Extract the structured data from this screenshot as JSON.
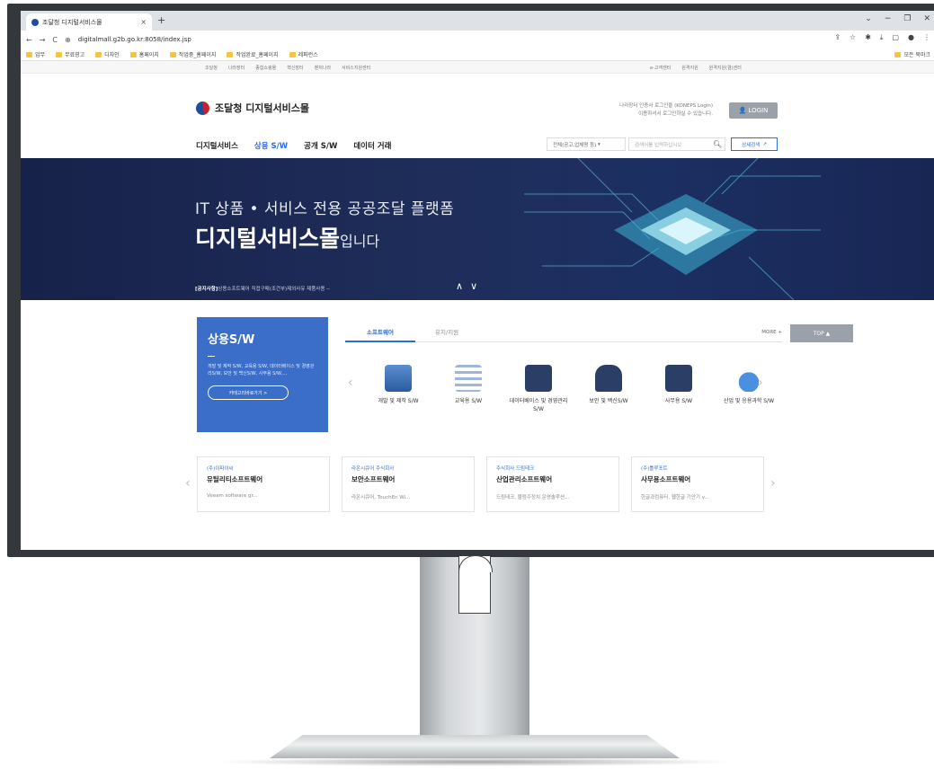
{
  "browser": {
    "tab_title": "조달청 디지털서비스몰",
    "tab_close": "×",
    "new_tab": "+",
    "url": "digitalmall.g2b.go.kr:8058/index.jsp",
    "bookmarks": [
      "업무",
      "무료광고",
      "디자인",
      "홈페이지",
      "작업중_홈페이지",
      "작업완료_홈페이지",
      "레퍼런스"
    ],
    "all_bookmarks": "모든 북마크"
  },
  "util_nav": {
    "left": [
      "조달청",
      "나라장터",
      "종합쇼핑몰",
      "혁신장터",
      "벤처나라",
      "서비스지원센터"
    ],
    "right": [
      "e-고객센터",
      "원격지원",
      "원격지원(결)센터"
    ]
  },
  "header": {
    "logo_text": "조달청 디지털서비스몰",
    "login_note_1": "나라장터 인증서 로그인을 (KONEPS Login)",
    "login_note_2": "이용하셔서 로그인하실 수 있습니다.",
    "login_label": "LOGIN"
  },
  "nav": {
    "items": [
      "디지털서비스",
      "상용 S/W",
      "공개 S/W",
      "데이터 거래"
    ],
    "search_select": "전체(공고,업체명 등)",
    "search_placeholder": "검색어를 입력하십시오",
    "detail_search": "상세검색"
  },
  "hero": {
    "line1": "IT 상품 • 서비스 전용 공공조달 플랫폼",
    "line2_bold": "디지털서비스몰",
    "line2_rest": "입니다",
    "notice_tag": "[공지사항]",
    "notice_text": "상용소프트웨어 직접구매(조건부)제외사유 제품사용 --",
    "arrows": "^ v"
  },
  "promo": {
    "title": "상용S/W",
    "desc": "개발 및 제작 S/W, 교육용 S/W, 데이터베이스 및 경영관리S/W, 보안 및 백신S/W, 사무용 S/W,...",
    "button": "카테고리바로가기 >"
  },
  "section_tabs": {
    "tab1": "소프트웨어",
    "tab2": "유지/지원",
    "more": "MORE +",
    "top": "TOP ▲"
  },
  "categories": [
    {
      "label": "개발 및 제작 S/W",
      "icon": "developer-icon"
    },
    {
      "label": "교육용 S/W",
      "icon": "list-icon"
    },
    {
      "label": "데이터베이스 및 경영관리S/W",
      "icon": "floppy-icon"
    },
    {
      "label": "보안 및 백신S/W",
      "icon": "lock-icon"
    },
    {
      "label": "사무용 S/W",
      "icon": "briefcase-icon"
    },
    {
      "label": "산업 및 응용과학 S/W",
      "icon": "flask-icon"
    }
  ],
  "products": [
    {
      "company": "(주)이파이씨",
      "title": "유틸리티소프트웨어",
      "desc": "Veeam software gr..."
    },
    {
      "company": "라온시큐어 주식회사",
      "title": "보안소프트웨어",
      "desc": "라온시큐어, TouchEn Wi..."
    },
    {
      "company": "주식회사 드림테크",
      "title": "산업관리소프트웨어",
      "desc": "드림테크, 블럼주정치 운영솔루션..."
    },
    {
      "company": "(주)틀루포트",
      "title": "사무용소프트웨어",
      "desc": "한글과컴퓨터, 웹한글 기안기 v..."
    }
  ],
  "colors": {
    "accent": "#2c6be0",
    "promo": "#3b6ec8",
    "hero": "#1f2d5a"
  }
}
